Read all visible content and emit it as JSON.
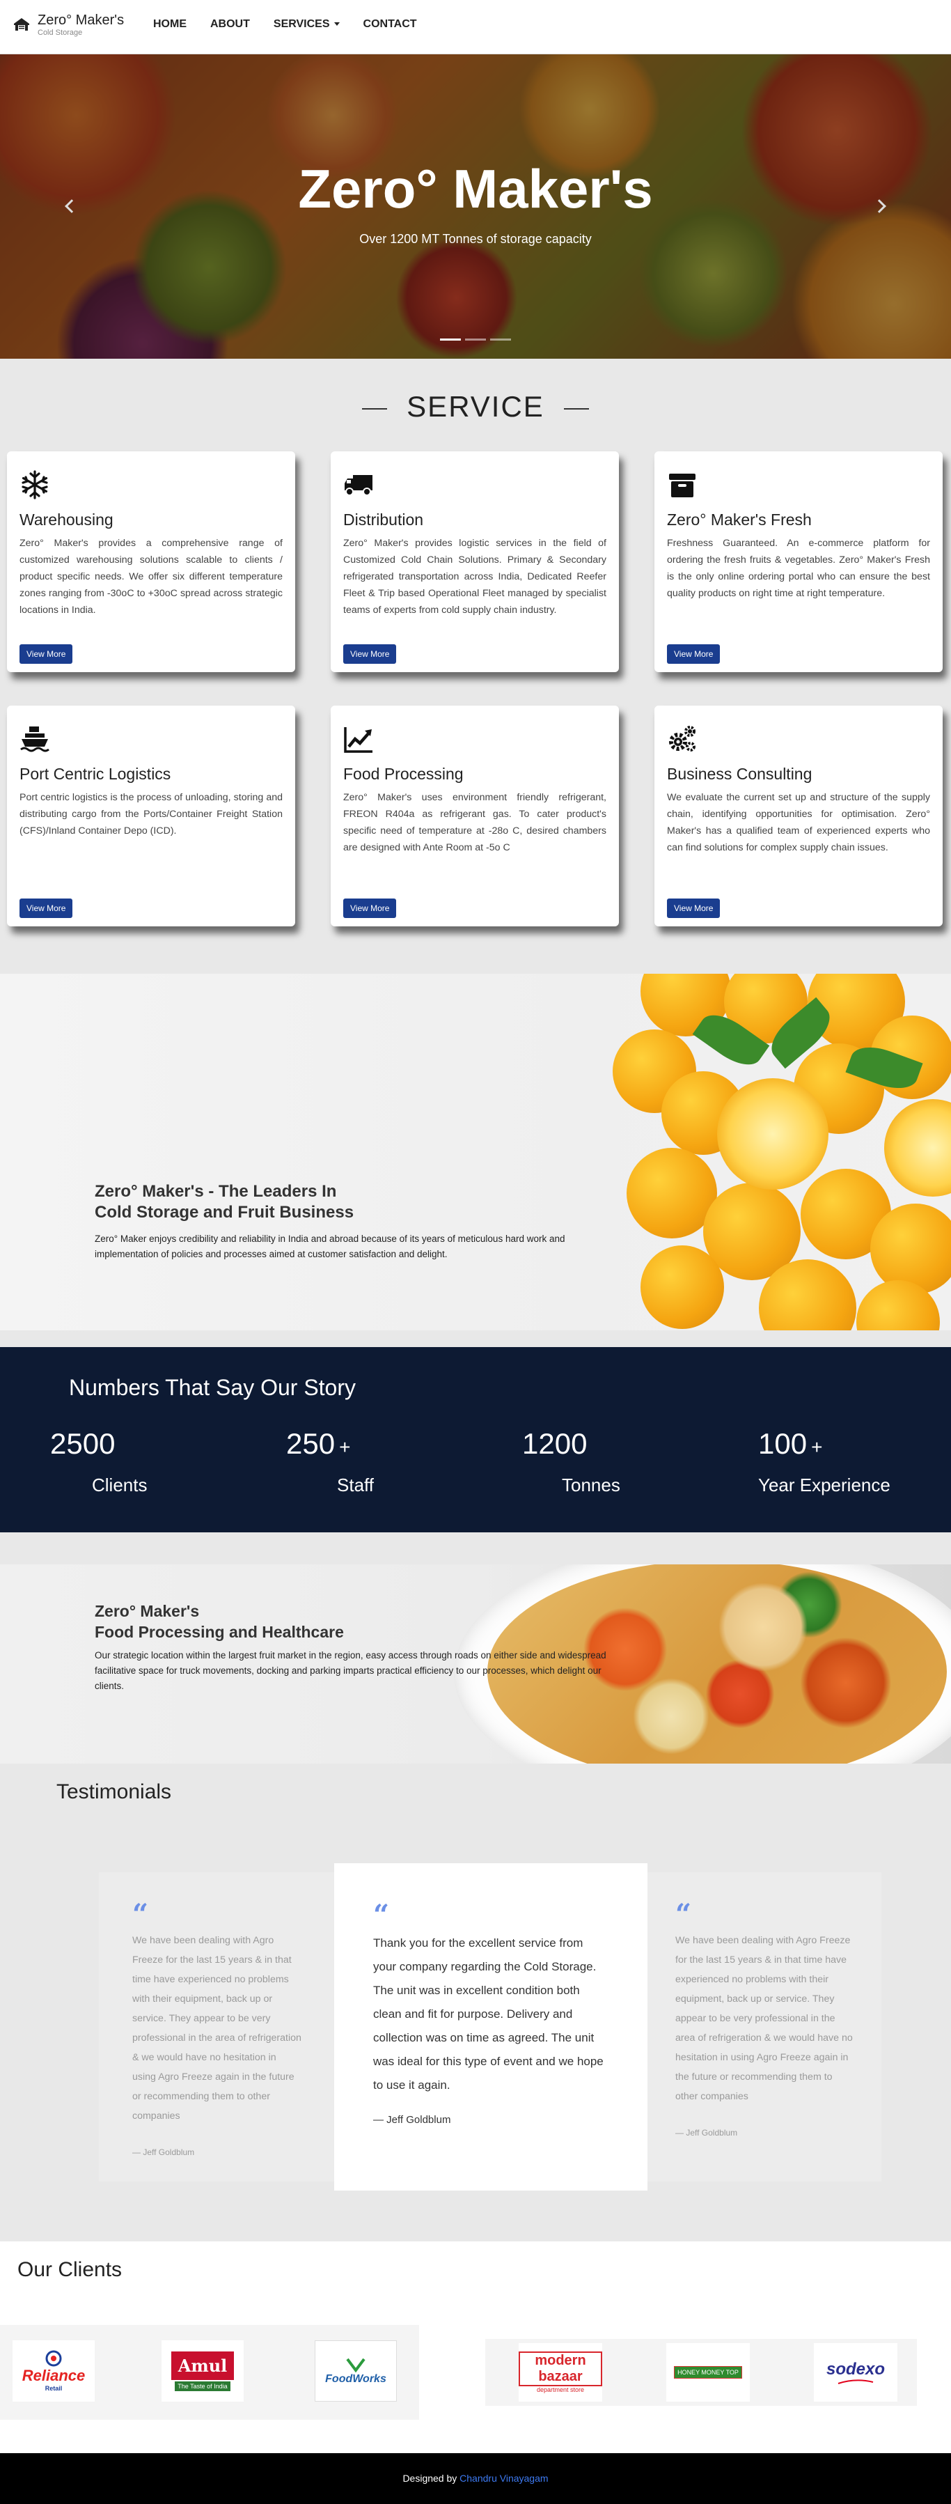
{
  "brand": {
    "name": "Zero° Maker's",
    "subtitle": "Cold Storage",
    "logo_icon": "storage-building-icon"
  },
  "nav": {
    "home": "HOME",
    "about": "ABOUT",
    "services": "SERVICES",
    "contact": "CONTACT"
  },
  "hero": {
    "title": "Zero° Maker's",
    "subtitle": "Over 1200 MT Tonnes of storage capacity",
    "slide_count": 3,
    "active_slide": 1
  },
  "service": {
    "heading": "SERVICE",
    "button_label": "View More",
    "cards": [
      {
        "icon": "snowflake-icon",
        "title": "Warehousing",
        "text": "Zero° Maker's provides a comprehensive range of customized warehousing solutions scalable to clients / product specific needs. We offer six different temperature zones ranging from -30oC to +30oC spread across strategic locations in India."
      },
      {
        "icon": "truck-icon",
        "title": "Distribution",
        "text": "Zero° Maker's provides logistic services in the field of Customized Cold Chain Solutions. Primary & Secondary refrigerated transportation across India, Dedicated Reefer Fleet & Trip based Operational Fleet managed by specialist teams of experts from cold supply chain industry."
      },
      {
        "icon": "archive-box-icon",
        "title": "Zero° Maker's Fresh",
        "text": "Freshness Guaranteed. An e-commerce platform for ordering the fresh fruits & vegetables. Zero° Maker's Fresh is the only online ordering portal who can ensure the best quality products on right time at right temperature."
      },
      {
        "icon": "ship-icon",
        "title": "Port Centric Logistics",
        "text": "Port centric logistics is the process of unloading, storing and distributing cargo from the Ports/Container Freight Station (CFS)/Inland Container Depo (ICD)."
      },
      {
        "icon": "line-chart-icon",
        "title": "Food Processing",
        "text": "Zero° Maker's uses environment friendly refrigerant, FREON R404a as refrigerant gas. To cater product's specific need of temperature at -28o C, desired chambers are designed with Ante Room at -5o C"
      },
      {
        "icon": "gears-icon",
        "title": "Business Consulting",
        "text": "We evaluate the current set up and structure of the supply chain, identifying opportunities for optimisation. Zero° Maker's has a qualified team of experienced experts who can find solutions for complex supply chain issues."
      }
    ]
  },
  "leaders": {
    "title_line1": "Zero° Maker's - The Leaders In",
    "title_line2": "Cold Storage and Fruit Business",
    "text": "Zero° Maker enjoys credibility and reliability in India and abroad because of its years of meticulous hard work and implementation of policies and processes aimed at customer satisfaction and delight."
  },
  "numbers": {
    "title": "Numbers That Say Our Story",
    "stats": [
      {
        "value": "2500",
        "suffix": "",
        "label": "Clients"
      },
      {
        "value": "250",
        "suffix": "+",
        "label": "Staff"
      },
      {
        "value": "1200",
        "suffix": "",
        "label": "Tonnes"
      },
      {
        "value": "100",
        "suffix": "+",
        "label": "Year Experience"
      }
    ]
  },
  "food": {
    "title_line1": "Zero° Maker's",
    "title_line2": "Food Processing and Healthcare",
    "text": "Our strategic location within the largest fruit market in the region, easy access through roads on either side and widespread facilitative space for truck movements, docking and parking imparts practical efficiency to our processes, which delight our clients."
  },
  "testimonials": {
    "title": "Testimonials",
    "items": [
      {
        "text": "We have been dealing with Agro Freeze for the last 15 years & in that time have experienced no problems with their equipment, back up or service. They appear to be very professional in the area of refrigeration & we would have no hesitation in using Agro Freeze again in the future or recommending them to other companies",
        "author": "— Jeff Goldblum"
      },
      {
        "text": "Thank you for the excellent service from your company regarding the Cold Storage. The unit was in excellent condition both clean and fit for purpose. Delivery and collection was on time as agreed. The unit was ideal for this type of event and we hope to use it again.",
        "author": "— Jeff Goldblum"
      },
      {
        "text": "We have been dealing with Agro Freeze for the last 15 years & in that time have experienced no problems with their equipment, back up or service. They appear to be very professional in the area of refrigeration & we would have no hesitation in using Agro Freeze again in the future or recommending them to other companies",
        "author": "— Jeff Goldblum"
      }
    ]
  },
  "clients": {
    "title": "Our Clients",
    "logos": [
      {
        "name": "Reliance",
        "tagline": "Retail"
      },
      {
        "name": "Amul",
        "tagline": "The Taste of India"
      },
      {
        "name": "FoodWorks",
        "tagline": ""
      },
      {
        "name": "modern bazaar",
        "tagline": "department store"
      },
      {
        "name": "HONEY MONEY TOP",
        "tagline": ""
      },
      {
        "name": "sodexo",
        "tagline": ""
      }
    ]
  },
  "footer": {
    "prefix": "Designed by",
    "author": "Chandru Vinayagam"
  },
  "colors": {
    "navy": "#0d1a33",
    "button": "#1a3d8f",
    "quote": "#6b8fe6",
    "link": "#3d79f0"
  }
}
